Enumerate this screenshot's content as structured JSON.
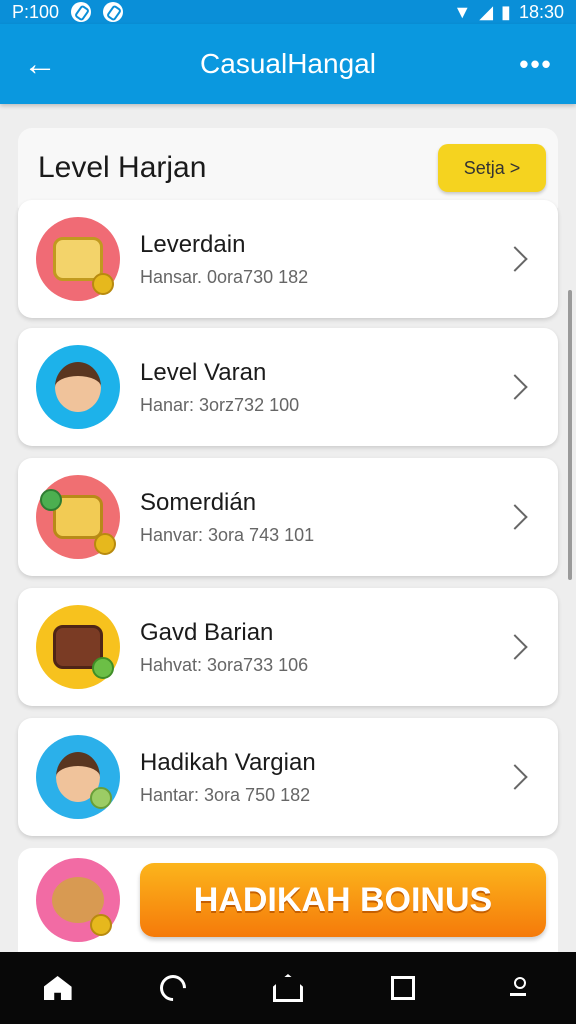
{
  "status_bar": {
    "left_text": "P:100",
    "time": "18:30",
    "icons": [
      "nfc-icon",
      "check-icon",
      "wifi-icon",
      "signal-icon",
      "battery-icon"
    ]
  },
  "app_bar": {
    "title": "CasualHangal",
    "back_icon": "back-arrow-icon",
    "more_icon": "more-dots-icon",
    "more_label": "•••",
    "color": "#0a98df"
  },
  "header_card": {
    "title": "Level Harjan",
    "button_label": "Setja >",
    "button_color": "#f5d31f"
  },
  "list": [
    {
      "title": "Leverdain",
      "subtitle": "Hansar. 0ora730 182",
      "icon": "calculator-coins-icon"
    },
    {
      "title": "Level Varan",
      "subtitle": "Hanar: 3orz732 100",
      "icon": "boy-waving-icon"
    },
    {
      "title": "Somerdián",
      "subtitle": "Hanvar: 3ora 743 101",
      "icon": "cheese-block-icon"
    },
    {
      "title": "Gavd Barian",
      "subtitle": "Hahvat: 3ora733 106",
      "icon": "treasure-drum-icon"
    },
    {
      "title": "Hadikah Vargian",
      "subtitle": "Hantar: 3ora 750 182",
      "icon": "girl-money-icon"
    }
  ],
  "bonus": {
    "label": "HADIKAH BOINUS",
    "icon": "teddy-bear-icon",
    "color_top": "#fcb51c",
    "color_bottom": "#f57a0a"
  },
  "nav_bar": {
    "items": [
      "home-icon",
      "search-icon",
      "home-outline-icon",
      "square-icon",
      "person-icon"
    ]
  }
}
